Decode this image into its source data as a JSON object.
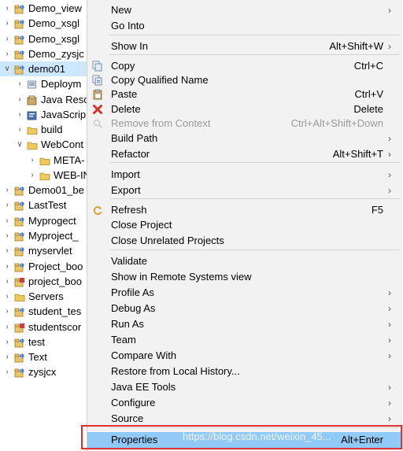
{
  "tree": {
    "items": [
      {
        "label": "Demo_view",
        "twisty": ">",
        "icon": "project-icon",
        "level": 0
      },
      {
        "label": "Demo_xsgl",
        "twisty": ">",
        "icon": "project-icon",
        "level": 0
      },
      {
        "label": "Demo_xsgl",
        "twisty": ">",
        "icon": "project-icon",
        "level": 0
      },
      {
        "label": "Demo_zysjc",
        "twisty": ">",
        "icon": "project-icon",
        "level": 0
      },
      {
        "label": "demo01",
        "twisty": "v",
        "icon": "project-icon",
        "level": 0,
        "selected": true
      },
      {
        "label": "Deploym",
        "twisty": ">",
        "icon": "deployment-icon",
        "level": 1
      },
      {
        "label": "Java Resc",
        "twisty": ">",
        "icon": "java-resources-icon",
        "level": 1
      },
      {
        "label": "JavaScrip",
        "twisty": ">",
        "icon": "javascript-icon",
        "level": 1
      },
      {
        "label": "build",
        "twisty": ">",
        "icon": "folder-icon",
        "level": 1
      },
      {
        "label": "WebCont",
        "twisty": "v",
        "icon": "folder-icon",
        "level": 1
      },
      {
        "label": "META-",
        "twisty": ">",
        "icon": "folder-icon",
        "level": 2
      },
      {
        "label": "WEB-IN",
        "twisty": ">",
        "icon": "folder-icon",
        "level": 2
      },
      {
        "label": "Demo01_be",
        "twisty": ">",
        "icon": "project-icon",
        "level": 0
      },
      {
        "label": "LastTest",
        "twisty": ">",
        "icon": "project-icon",
        "level": 0
      },
      {
        "label": "Myprogect",
        "twisty": ">",
        "icon": "project-icon",
        "level": 0
      },
      {
        "label": "Myproject_",
        "twisty": ">",
        "icon": "project-icon",
        "level": 0
      },
      {
        "label": "myservlet",
        "twisty": ">",
        "icon": "project-icon",
        "level": 0
      },
      {
        "label": "Project_boo",
        "twisty": ">",
        "icon": "project-icon",
        "level": 0
      },
      {
        "label": "project_boo",
        "twisty": ">",
        "icon": "project-error-icon",
        "level": 0
      },
      {
        "label": "Servers",
        "twisty": ">",
        "icon": "folder-icon",
        "level": 0
      },
      {
        "label": "student_tes",
        "twisty": ">",
        "icon": "project-icon",
        "level": 0
      },
      {
        "label": "studentscor",
        "twisty": ">",
        "icon": "project-error-icon",
        "level": 0
      },
      {
        "label": "test",
        "twisty": ">",
        "icon": "project-icon",
        "level": 0
      },
      {
        "label": "Text",
        "twisty": ">",
        "icon": "project-icon",
        "level": 0
      },
      {
        "label": "zysjcx",
        "twisty": ">",
        "icon": "project-icon",
        "level": 0
      }
    ]
  },
  "menu": {
    "items": [
      {
        "label": "New",
        "shortcut": "",
        "submenu": true
      },
      {
        "label": "Go Into",
        "shortcut": "",
        "submenu": false
      },
      {
        "sep": true
      },
      {
        "label": "Show In",
        "shortcut": "Alt+Shift+W",
        "submenu": true
      },
      {
        "sep": true
      },
      {
        "label": "Copy",
        "shortcut": "Ctrl+C",
        "submenu": false,
        "icon": "copy-icon"
      },
      {
        "label": "Copy Qualified Name",
        "shortcut": "",
        "submenu": false,
        "icon": "copy-qualified-icon"
      },
      {
        "label": "Paste",
        "shortcut": "Ctrl+V",
        "submenu": false,
        "icon": "paste-icon"
      },
      {
        "label": "Delete",
        "shortcut": "Delete",
        "submenu": false,
        "icon": "delete-icon"
      },
      {
        "label": "Remove from Context",
        "shortcut": "Ctrl+Alt+Shift+Down",
        "submenu": false,
        "disabled": true,
        "icon": "remove-context-icon"
      },
      {
        "label": "Build Path",
        "shortcut": "",
        "submenu": true
      },
      {
        "label": "Refactor",
        "shortcut": "Alt+Shift+T",
        "submenu": true
      },
      {
        "sep": true
      },
      {
        "label": "Import",
        "shortcut": "",
        "submenu": true
      },
      {
        "label": "Export",
        "shortcut": "",
        "submenu": true
      },
      {
        "sep": true
      },
      {
        "label": "Refresh",
        "shortcut": "F5",
        "submenu": false,
        "icon": "refresh-icon"
      },
      {
        "label": "Close Project",
        "shortcut": "",
        "submenu": false
      },
      {
        "label": "Close Unrelated Projects",
        "shortcut": "",
        "submenu": false
      },
      {
        "sep": true
      },
      {
        "label": "Validate",
        "shortcut": "",
        "submenu": false
      },
      {
        "label": "Show in Remote Systems view",
        "shortcut": "",
        "submenu": false
      },
      {
        "label": "Profile As",
        "shortcut": "",
        "submenu": true
      },
      {
        "label": "Debug As",
        "shortcut": "",
        "submenu": true
      },
      {
        "label": "Run As",
        "shortcut": "",
        "submenu": true
      },
      {
        "label": "Team",
        "shortcut": "",
        "submenu": true
      },
      {
        "label": "Compare With",
        "shortcut": "",
        "submenu": true
      },
      {
        "label": "Restore from Local History...",
        "shortcut": "",
        "submenu": false
      },
      {
        "label": "Java EE Tools",
        "shortcut": "",
        "submenu": true
      },
      {
        "label": "Configure",
        "shortcut": "",
        "submenu": true
      },
      {
        "label": "Source",
        "shortcut": "",
        "submenu": true
      },
      {
        "sep": true
      },
      {
        "label": "Properties",
        "shortcut": "Alt+Enter",
        "submenu": false,
        "highlighted": true
      }
    ]
  },
  "watermark": "https://blog.csdn.net/weixin_45...",
  "colors": {
    "selection": "#cce8ff",
    "menu_bg": "#f2f2f2",
    "menu_highlight": "#91c9f7",
    "callout_border": "#e03030"
  }
}
